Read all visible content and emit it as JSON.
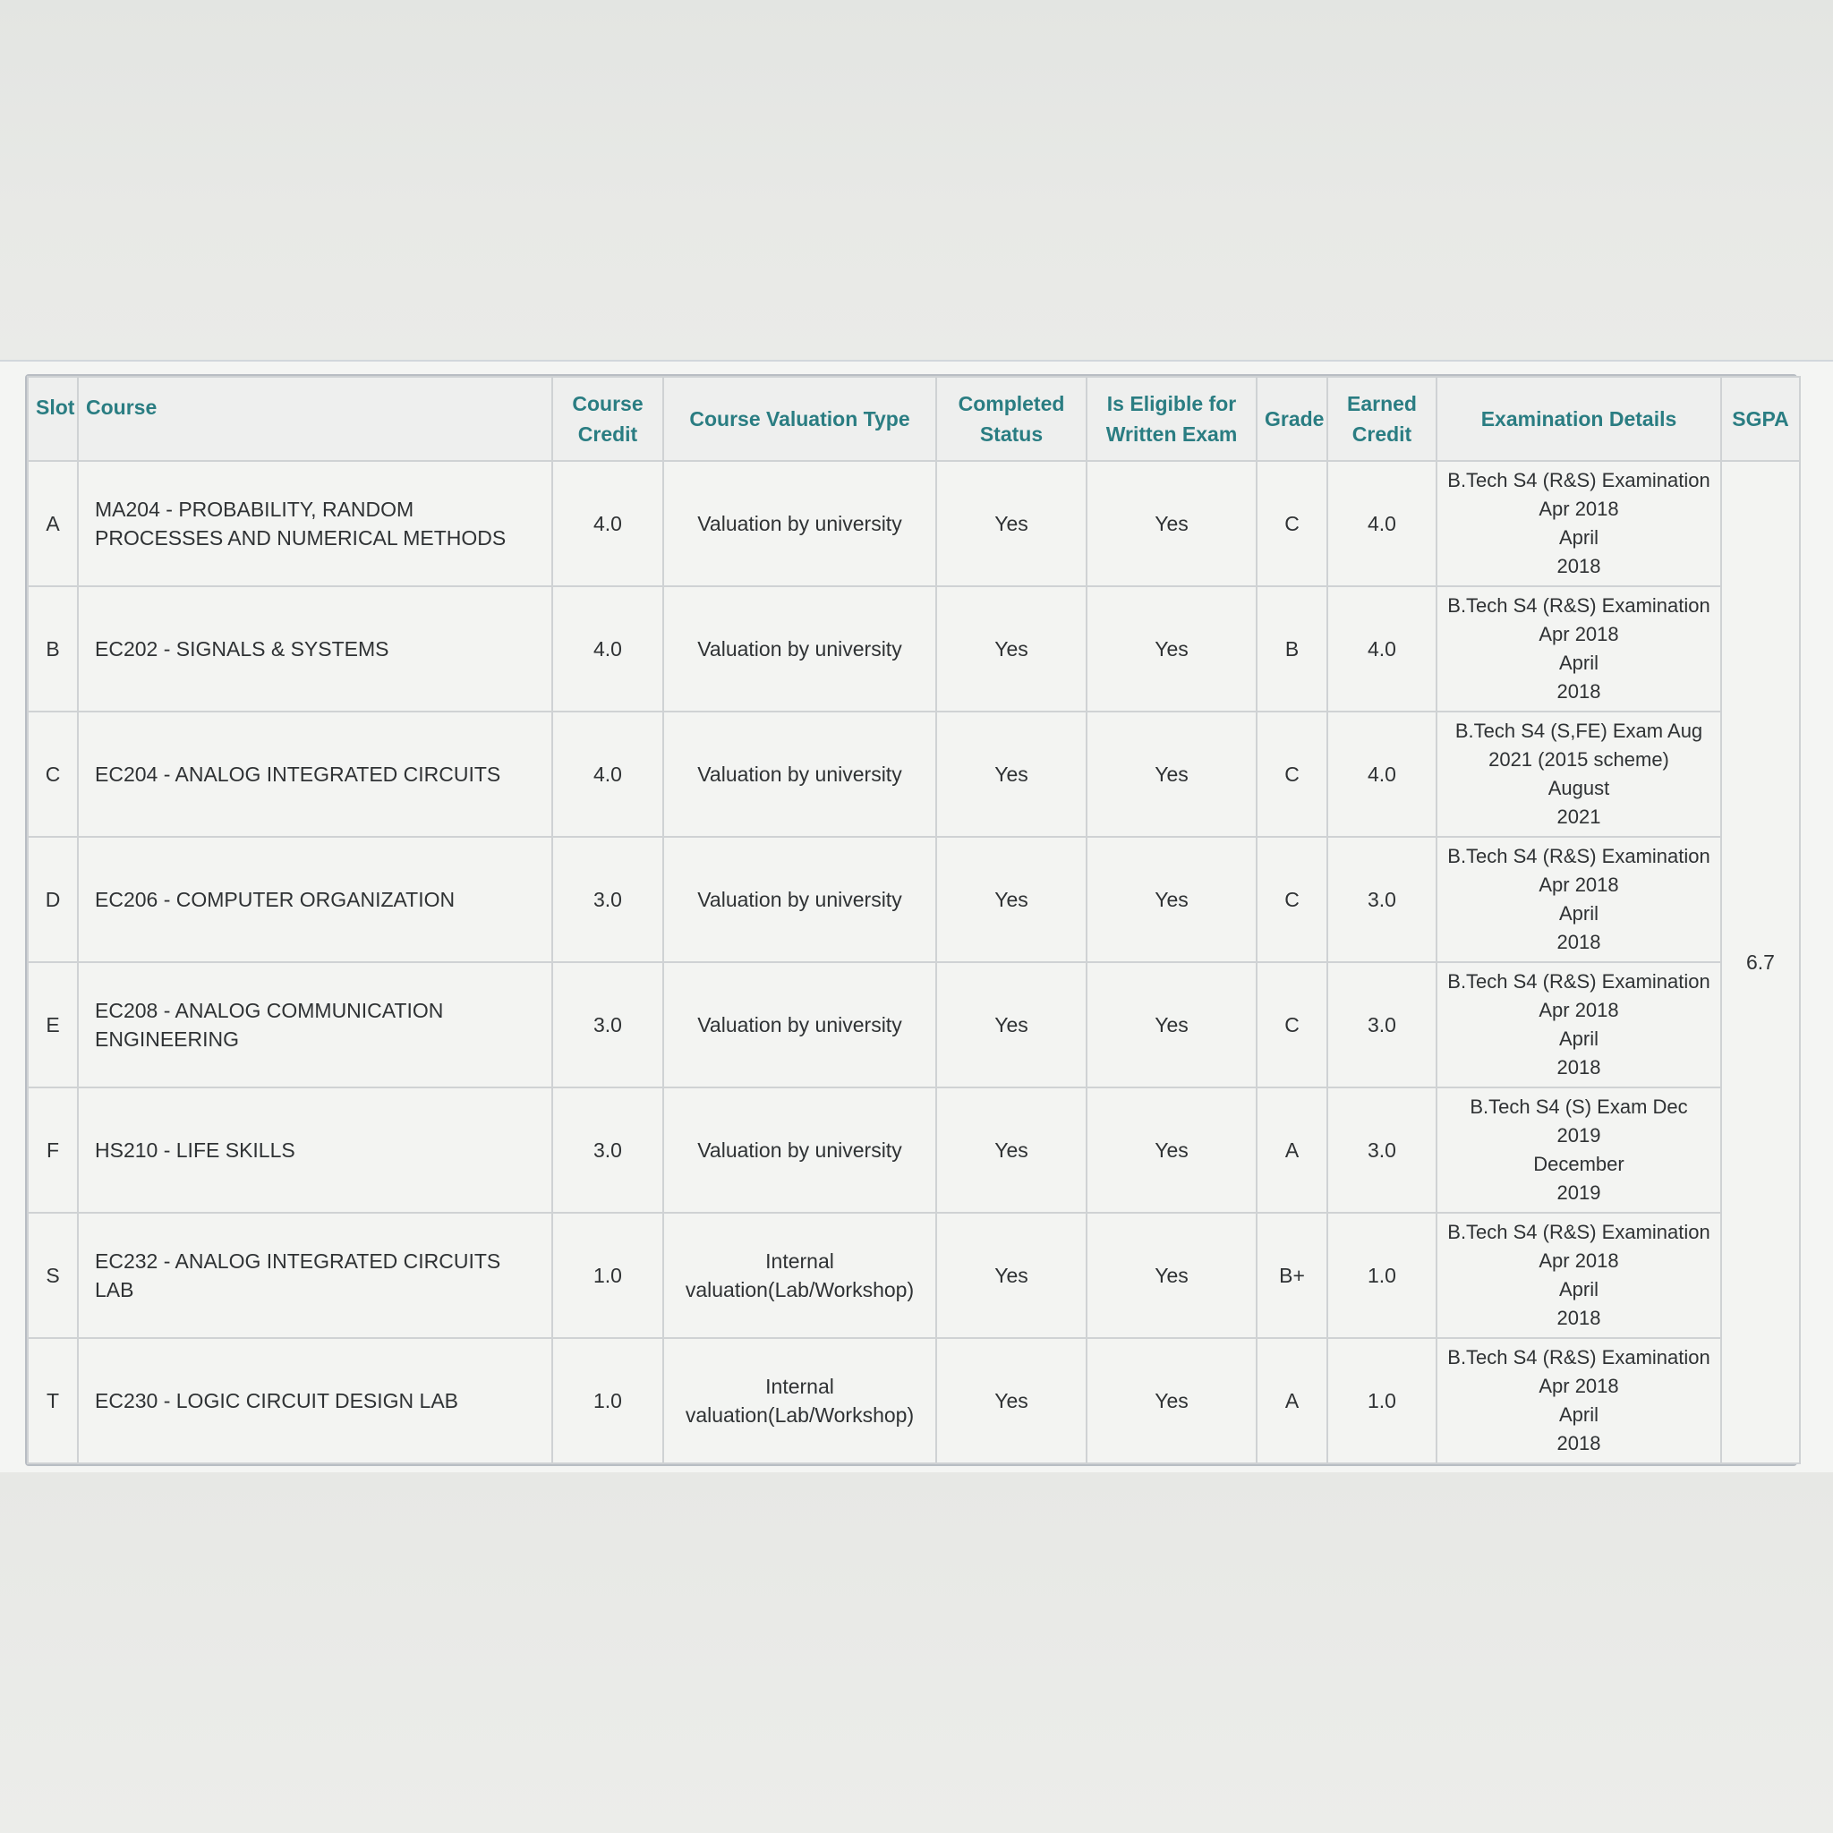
{
  "table": {
    "headers": {
      "slot": "Slot",
      "course": "Course",
      "course_credit": "Course Credit",
      "valuation_type": "Course Valuation Type",
      "completed_status": "Completed Status",
      "eligible": "Is Eligible for Written Exam",
      "grade": "Grade",
      "earned_credit": "Earned Credit",
      "exam_details": "Examination Details",
      "sgpa": "SGPA"
    },
    "sgpa_value": "6.7",
    "rows": [
      {
        "slot": "A",
        "course": "MA204 - PROBABILITY, RANDOM PROCESSES AND NUMERICAL METHODS",
        "credit": "4.0",
        "valuation": "Valuation by university",
        "completed": "Yes",
        "eligible": "Yes",
        "grade": "C",
        "earned": "4.0",
        "exam": [
          "B.Tech S4 (R&S) Examination",
          "Apr 2018",
          "April",
          "2018"
        ]
      },
      {
        "slot": "B",
        "course": "EC202 - SIGNALS & SYSTEMS",
        "credit": "4.0",
        "valuation": "Valuation by university",
        "completed": "Yes",
        "eligible": "Yes",
        "grade": "B",
        "earned": "4.0",
        "exam": [
          "B.Tech S4 (R&S) Examination",
          "Apr 2018",
          "April",
          "2018"
        ]
      },
      {
        "slot": "C",
        "course": "EC204 - ANALOG INTEGRATED CIRCUITS",
        "credit": "4.0",
        "valuation": "Valuation by university",
        "completed": "Yes",
        "eligible": "Yes",
        "grade": "C",
        "earned": "4.0",
        "exam": [
          "B.Tech S4 (S,FE) Exam Aug",
          "2021 (2015 scheme)",
          "August",
          "2021"
        ]
      },
      {
        "slot": "D",
        "course": "EC206 - COMPUTER ORGANIZATION",
        "credit": "3.0",
        "valuation": "Valuation by university",
        "completed": "Yes",
        "eligible": "Yes",
        "grade": "C",
        "earned": "3.0",
        "exam": [
          "B.Tech S4 (R&S) Examination",
          "Apr 2018",
          "April",
          "2018"
        ]
      },
      {
        "slot": "E",
        "course": "EC208 - ANALOG COMMUNICATION ENGINEERING",
        "credit": "3.0",
        "valuation": "Valuation by university",
        "completed": "Yes",
        "eligible": "Yes",
        "grade": "C",
        "earned": "3.0",
        "exam": [
          "B.Tech S4 (R&S) Examination",
          "Apr 2018",
          "April",
          "2018"
        ]
      },
      {
        "slot": "F",
        "course": "HS210 - LIFE SKILLS",
        "credit": "3.0",
        "valuation": "Valuation by university",
        "completed": "Yes",
        "eligible": "Yes",
        "grade": "A",
        "earned": "3.0",
        "exam": [
          "B.Tech S4 (S) Exam Dec",
          "2019",
          "December",
          "2019"
        ]
      },
      {
        "slot": "S",
        "course": "EC232 - ANALOG INTEGRATED CIRCUITS LAB",
        "credit": "1.0",
        "valuation": "Internal valuation(Lab/Workshop)",
        "completed": "Yes",
        "eligible": "Yes",
        "grade": "B+",
        "earned": "1.0",
        "exam": [
          "B.Tech S4 (R&S) Examination",
          "Apr 2018",
          "April",
          "2018"
        ]
      },
      {
        "slot": "T",
        "course": "EC230 - LOGIC CIRCUIT DESIGN LAB",
        "credit": "1.0",
        "valuation": "Internal valuation(Lab/Workshop)",
        "completed": "Yes",
        "eligible": "Yes",
        "grade": "A",
        "earned": "1.0",
        "exam": [
          "B.Tech S4 (R&S) Examination",
          "Apr 2018",
          "April",
          "2018"
        ]
      }
    ]
  }
}
